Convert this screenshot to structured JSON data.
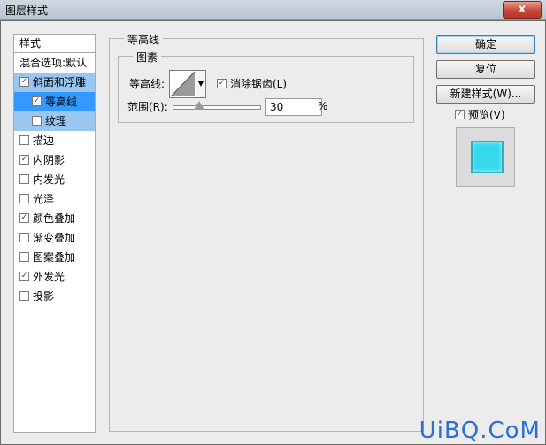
{
  "window": {
    "title": "图层样式",
    "close_label": "x"
  },
  "list": {
    "header": "样式",
    "items": [
      {
        "label": "混合选项:默认",
        "check": ""
      },
      {
        "label": "斜面和浮雕",
        "check": "✓"
      },
      {
        "label": "等高线",
        "check": "✓"
      },
      {
        "label": "纹理",
        "check": ""
      },
      {
        "label": "描边",
        "check": ""
      },
      {
        "label": "内阴影",
        "check": "✓"
      },
      {
        "label": "内发光",
        "check": ""
      },
      {
        "label": "光泽",
        "check": ""
      },
      {
        "label": "颜色叠加",
        "check": "✓"
      },
      {
        "label": "渐变叠加",
        "check": ""
      },
      {
        "label": "图案叠加",
        "check": ""
      },
      {
        "label": "外发光",
        "check": "✓"
      },
      {
        "label": "投影",
        "check": ""
      }
    ]
  },
  "contour_panel": {
    "group_title": "等高线",
    "subgroup_title": "图素",
    "contour_label": "等高线:",
    "antialias_label": "消除锯齿(L)",
    "antialias_check": "✓",
    "range_label": "范围(R):",
    "range_value": "30",
    "range_unit": "%",
    "range_fraction": 0.3
  },
  "buttons": {
    "ok": "确定",
    "reset": "复位",
    "new_style": "新建样式(W)..."
  },
  "preview": {
    "label": "预览(V)",
    "check": "✓",
    "swatch_color": "#35d8ec"
  },
  "watermark": "UiBQ.CoM"
}
